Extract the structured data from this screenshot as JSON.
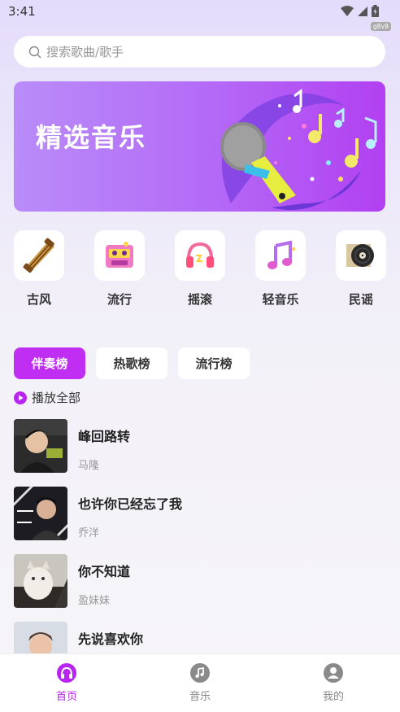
{
  "status": {
    "time": "3:41",
    "tag": "g8v8"
  },
  "search": {
    "placeholder": "搜索歌曲/歌手",
    "icon": "search-icon"
  },
  "banner": {
    "title": "精选音乐"
  },
  "categories": [
    {
      "label": "古风",
      "icon": "guzheng-icon"
    },
    {
      "label": "流行",
      "icon": "cassette-icon"
    },
    {
      "label": "摇滚",
      "icon": "headphones-icon"
    },
    {
      "label": "轻音乐",
      "icon": "music-note-icon"
    },
    {
      "label": "民谣",
      "icon": "vinyl-record-icon"
    }
  ],
  "tabs": [
    {
      "label": "伴奏榜",
      "active": true
    },
    {
      "label": "热歌榜",
      "active": false
    },
    {
      "label": "流行榜",
      "active": false
    }
  ],
  "play_all": {
    "label": "播放全部"
  },
  "songs": [
    {
      "title": "峰回路转",
      "singer": "马隆"
    },
    {
      "title": "也许你已经忘了我",
      "singer": "乔洋"
    },
    {
      "title": "你不知道",
      "singer": "盈妹妹"
    },
    {
      "title": "先说喜欢你",
      "singer": ""
    }
  ],
  "nav": [
    {
      "label": "首页",
      "icon": "headphones-icon",
      "active": true
    },
    {
      "label": "音乐",
      "icon": "music-disc-icon",
      "active": false
    },
    {
      "label": "我的",
      "icon": "user-icon",
      "active": false
    }
  ],
  "colors": {
    "accent": "#c12ef3",
    "nav_active": "#b925f0"
  }
}
